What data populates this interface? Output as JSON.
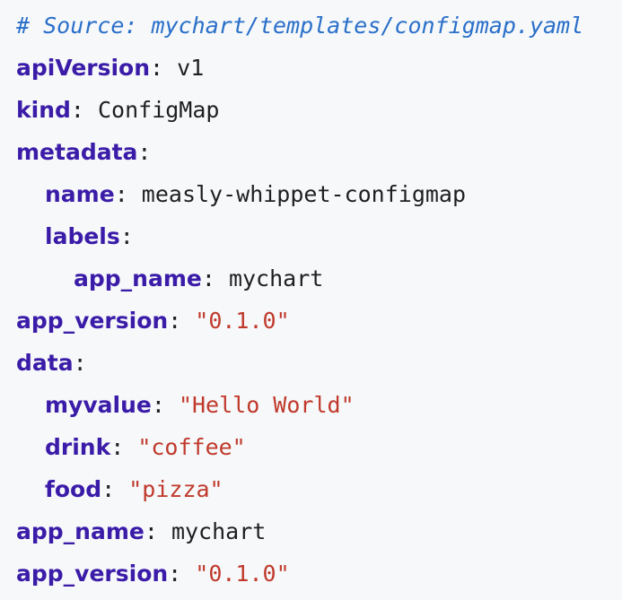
{
  "code": {
    "comment": "# Source: mychart/templates/configmap.yaml",
    "lines": [
      {
        "key": "apiVersion",
        "sep": ": ",
        "value": "v1",
        "type": "plain",
        "indent": 0
      },
      {
        "key": "kind",
        "sep": ": ",
        "value": "ConfigMap",
        "type": "plain",
        "indent": 0
      },
      {
        "key": "metadata",
        "sep": ":",
        "value": "",
        "type": "plain",
        "indent": 0
      },
      {
        "key": "name",
        "sep": ": ",
        "value": "measly-whippet-configmap",
        "type": "plain",
        "indent": 1
      },
      {
        "key": "labels",
        "sep": ":",
        "value": "",
        "type": "plain",
        "indent": 1
      },
      {
        "key": "app_name",
        "sep": ": ",
        "value": "mychart",
        "type": "plain",
        "indent": 2
      },
      {
        "key": "app_version",
        "sep": ": ",
        "value": "\"0.1.0\"",
        "type": "string",
        "indent": 0
      },
      {
        "key": "data",
        "sep": ":",
        "value": "",
        "type": "plain",
        "indent": 0
      },
      {
        "key": "myvalue",
        "sep": ": ",
        "value": "\"Hello World\"",
        "type": "string",
        "indent": 1
      },
      {
        "key": "drink",
        "sep": ": ",
        "value": "\"coffee\"",
        "type": "string",
        "indent": 1
      },
      {
        "key": "food",
        "sep": ": ",
        "value": "\"pizza\"",
        "type": "string",
        "indent": 1
      },
      {
        "key": "app_name",
        "sep": ": ",
        "value": "mychart",
        "type": "plain",
        "indent": 0
      },
      {
        "key": "app_version",
        "sep": ": ",
        "value": "\"0.1.0\"",
        "type": "string",
        "indent": 0
      }
    ]
  },
  "colors": {
    "background": "#f6f8fa",
    "comment": "#2a6fc9",
    "key": "#3b1ca8",
    "string": "#c0392b",
    "plain": "#1f1f1f"
  }
}
